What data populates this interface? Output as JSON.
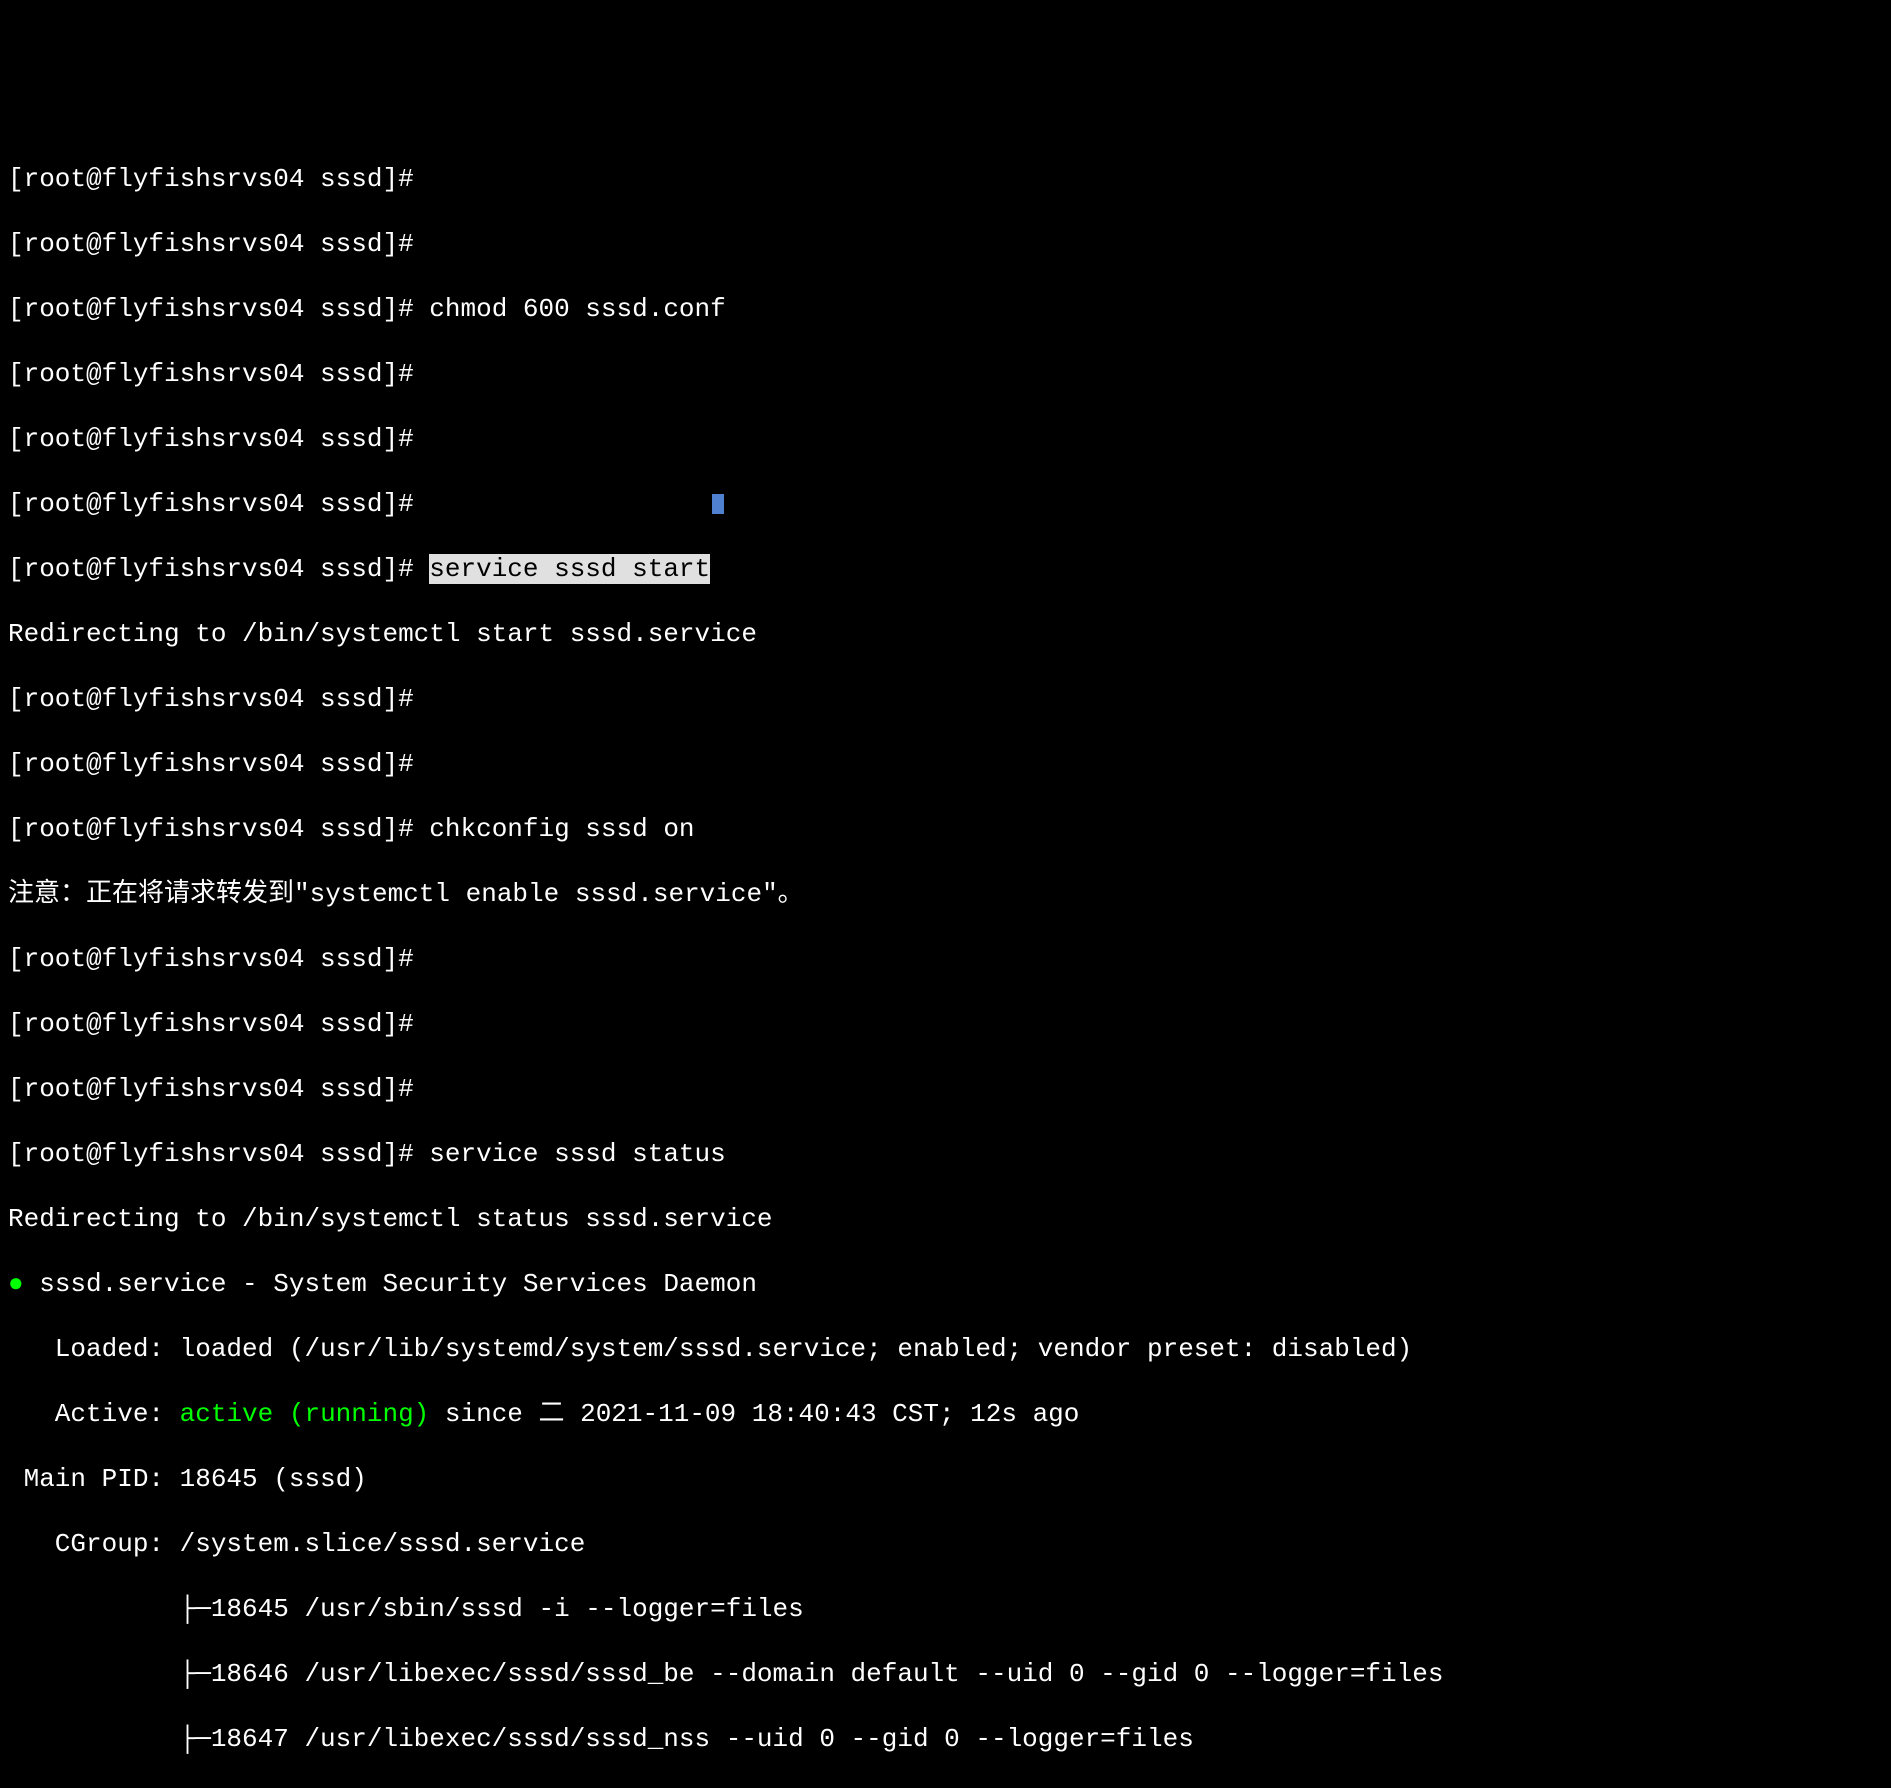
{
  "prompt": "[root@flyfishsrvs04 sssd]#",
  "lines": {
    "l0": "[root@flyfishsrvs04 sssd]#",
    "l1": "[root@flyfishsrvs04 sssd]#",
    "l2_prompt": "[root@flyfishsrvs04 sssd]# ",
    "l2_cmd": "chmod 600 sssd.conf",
    "l3": "[root@flyfishsrvs04 sssd]#",
    "l4": "[root@flyfishsrvs04 sssd]#",
    "l5": "[root@flyfishsrvs04 sssd]#",
    "l6_prompt": "[root@flyfishsrvs04 sssd]# ",
    "l6_cmd": "service sssd start",
    "l7": "Redirecting to /bin/systemctl start sssd.service",
    "l8": "[root@flyfishsrvs04 sssd]#",
    "l9": "[root@flyfishsrvs04 sssd]#",
    "l10_prompt": "[root@flyfishsrvs04 sssd]# ",
    "l10_cmd": "chkconfig sssd on",
    "l11": "注意：正在将请求转发到\"systemctl enable sssd.service\"。",
    "l12": "[root@flyfishsrvs04 sssd]#",
    "l13": "[root@flyfishsrvs04 sssd]#",
    "l14": "[root@flyfishsrvs04 sssd]#",
    "l15_prompt": "[root@flyfishsrvs04 sssd]# ",
    "l15_cmd": "service sssd status",
    "l16": "Redirecting to /bin/systemctl status sssd.service",
    "l17_bullet": "●",
    "l17_text": " sssd.service - System Security Services Daemon",
    "l18": "   Loaded: loaded (/usr/lib/systemd/system/sssd.service; enabled; vendor preset: disabled)",
    "l19_prefix": "   Active: ",
    "l19_active": "active (running)",
    "l19_suffix": " since 二 2021-11-09 18:40:43 CST; 12s ago",
    "l20": " Main PID: 18645 (sssd)",
    "l21": "   CGroup: /system.slice/sssd.service",
    "l22": "           ├─18645 /usr/sbin/sssd -i --logger=files",
    "l23": "           ├─18646 /usr/libexec/sssd/sssd_be --domain default --uid 0 --gid 0 --logger=files",
    "l24": "           ├─18647 /usr/libexec/sssd/sssd_nss --uid 0 --gid 0 --logger=files"
  }
}
